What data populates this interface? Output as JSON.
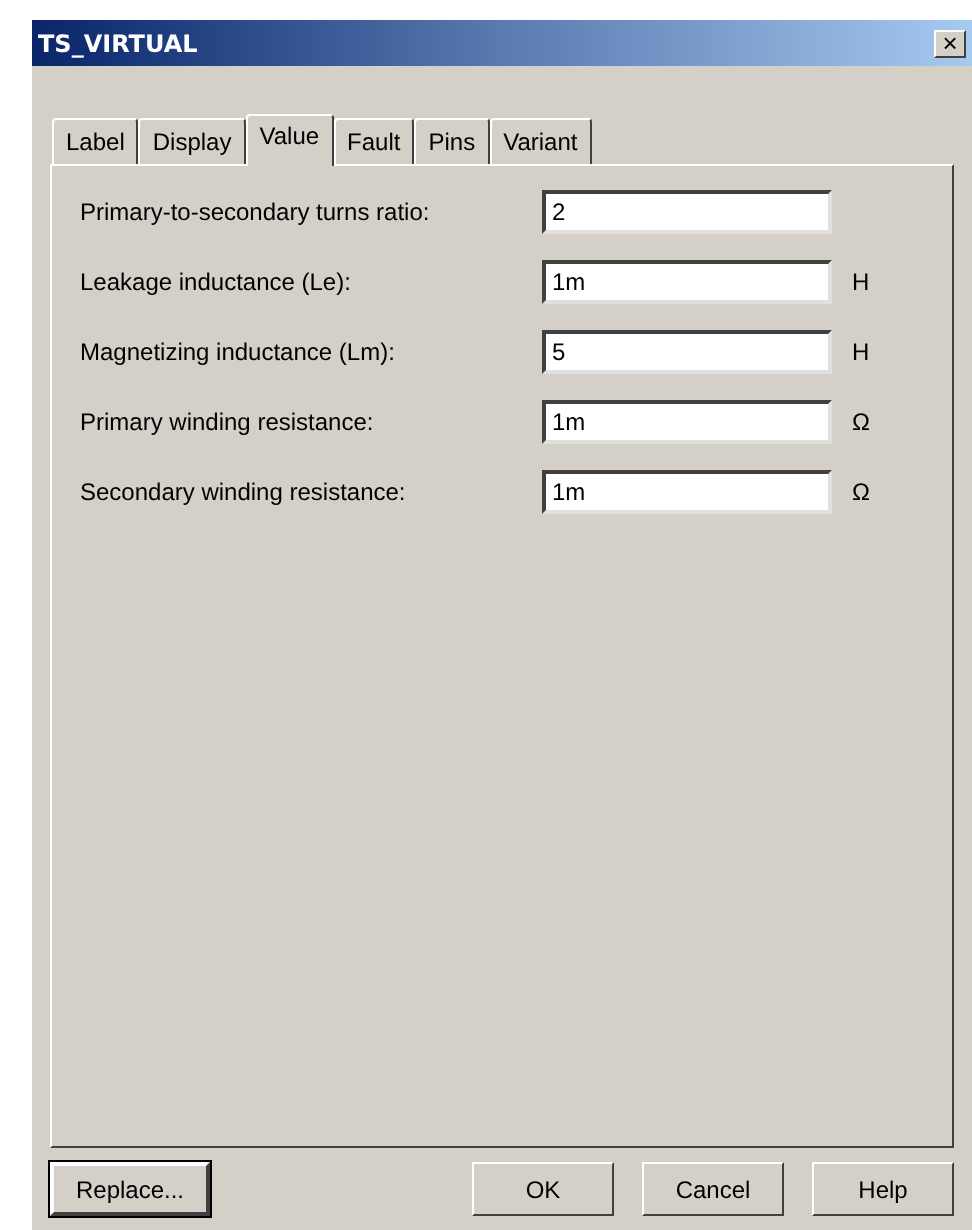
{
  "window": {
    "title": "TS_VIRTUAL",
    "close": "×"
  },
  "tabs": [
    {
      "label": "Label",
      "selected": false
    },
    {
      "label": "Display",
      "selected": false
    },
    {
      "label": "Value",
      "selected": true
    },
    {
      "label": "Fault",
      "selected": false
    },
    {
      "label": "Pins",
      "selected": false
    },
    {
      "label": "Variant",
      "selected": false
    }
  ],
  "fields": [
    {
      "label": "Primary-to-secondary turns ratio:",
      "value": "2"
    },
    {
      "label": "Leakage inductance (Le):",
      "value": "1m",
      "unit": "H"
    },
    {
      "label": "Magnetizing inductance (Lm):",
      "value": "5",
      "unit": "H"
    },
    {
      "label": "Primary winding resistance:",
      "value": "1m",
      "unit": "Ω"
    },
    {
      "label": "Secondary winding resistance:",
      "value": "1m",
      "unit": "Ω"
    }
  ],
  "buttons": [
    {
      "label": "Replace...",
      "default": true
    },
    {
      "label": "OK",
      "default": false
    },
    {
      "label": "Cancel",
      "default": false
    },
    {
      "label": "Help",
      "default": false
    }
  ]
}
